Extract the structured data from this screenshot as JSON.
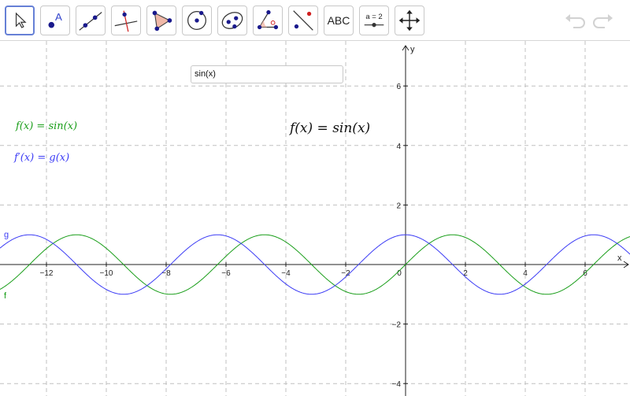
{
  "toolbar": {
    "tools": [
      {
        "name": "move-tool-button",
        "icon": "cursor-arrow-icon"
      },
      {
        "name": "point-tool-button",
        "icon": "point-A-icon",
        "label": "A"
      },
      {
        "name": "line-tool-button",
        "icon": "line-through-points-icon"
      },
      {
        "name": "perpendicular-tool-button",
        "icon": "perpendicular-line-icon"
      },
      {
        "name": "polygon-tool-button",
        "icon": "polygon-icon"
      },
      {
        "name": "circle-tool-button",
        "icon": "circle-center-point-icon"
      },
      {
        "name": "conic-tool-button",
        "icon": "ellipse-icon"
      },
      {
        "name": "angle-tool-button",
        "icon": "angle-icon"
      },
      {
        "name": "reflect-tool-button",
        "icon": "reflect-about-line-icon"
      },
      {
        "name": "text-tool-button",
        "icon": "text-icon",
        "label": "ABC"
      },
      {
        "name": "slider-tool-button",
        "icon": "slider-icon",
        "label": "a = 2"
      },
      {
        "name": "move-view-tool-button",
        "icon": "move-graphics-view-icon"
      }
    ],
    "undo_icon": "undo-icon",
    "redo_icon": "redo-icon"
  },
  "input_box": {
    "value": "sin(x)"
  },
  "algebra": {
    "f_label": "f(x) = sin(x)",
    "g_label": "f′(x) = g(x)"
  },
  "graph_text": "f(x) = sin(x)",
  "chart_data": {
    "type": "line",
    "xlabel": "x",
    "ylabel": "y",
    "xlim": [
      -13.4,
      7.6
    ],
    "ylim": [
      -4.2,
      7.4
    ],
    "grid": true,
    "x_ticks": [
      -12,
      -10,
      -8,
      -6,
      -4,
      -2,
      0,
      2,
      4,
      6
    ],
    "y_ticks": [
      -4,
      -2,
      2,
      4,
      6
    ],
    "series": [
      {
        "name": "f",
        "expression": "sin(x)",
        "color": "#1a9e1a"
      },
      {
        "name": "g",
        "expression": "cos(x)",
        "color": "#3c3cf5"
      }
    ]
  },
  "colors": {
    "f_color": "#1a9e1a",
    "g_color": "#3c3cf5",
    "grid_color": "#c0c0c0",
    "selected_border": "#6680d6"
  }
}
